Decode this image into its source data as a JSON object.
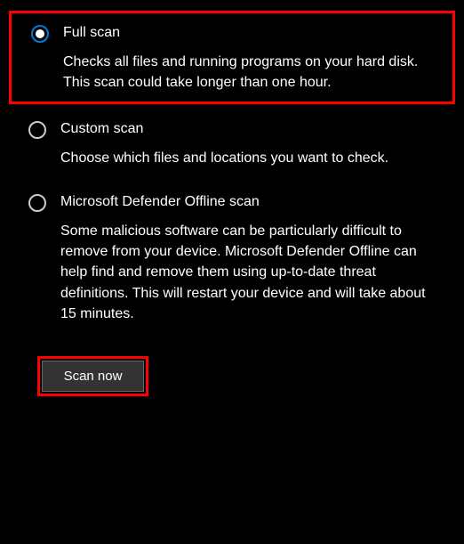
{
  "options": [
    {
      "label": "Full scan",
      "description": "Checks all files and running programs on your hard disk. This scan could take longer than one hour."
    },
    {
      "label": "Custom scan",
      "description": "Choose which files and locations you want to check."
    },
    {
      "label": "Microsoft Defender Offline scan",
      "description": "Some malicious software can be particularly difficult to remove from your device. Microsoft Defender Offline can help find and remove them using up-to-date threat definitions. This will restart your device and will take about 15 minutes."
    }
  ],
  "scan_button_label": "Scan now"
}
